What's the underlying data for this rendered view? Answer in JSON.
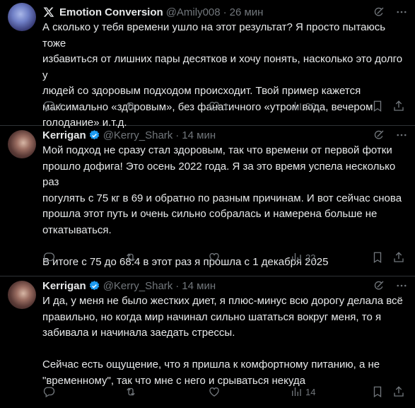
{
  "tweets": [
    {
      "name": "Emotion Conversion",
      "handle": "@Amily008",
      "time": "26 мин",
      "text": "А сколько у тебя времени ушло на этот результат? Я просто пытаюсь тоже\nизбавиться от лишних пары десятков и хочу понять, насколько это долго у\nлюдей со здоровым подходом происходит. Твой пример кажется\nмаксимально «здоровым», без фанатичного «утром вода, вечером\nголодание» и.т.д.",
      "replies": "1",
      "retweets": "",
      "likes": "1",
      "views": "30"
    },
    {
      "name": "Kerrigan",
      "handle": "@Kerry_Shark",
      "time": "14 мин",
      "text": "Мой подход не сразу стал здоровым, так что времени от первой фотки\nпрошло дофига! Это осень 2022 года. Я за это время успела несколько раз\nпогулять с 75 кг в 69 и обратно по разным причинам. И вот сейчас снова\nпрошла этот путь и очень сильно собралась и намерена больше не\nоткатываться.\n\nВ итоге с 75 до 68.4 в этот раз я прошла с 1 декабря 2025",
      "replies": "",
      "retweets": "",
      "likes": "",
      "views": "22"
    },
    {
      "name": "Kerrigan",
      "handle": "@Kerry_Shark",
      "time": "14 мин",
      "text": "И да, у меня не было жестких диет, я плюс-минус всю дорогу делала всё\nправильно, но когда мир начинал сильно шататься вокруг меня, то я\nзабивала и начинала заедать стрессы.\n\nСейчас есть ощущение, что я пришла к комфортному питанию, а не\n\"временному\", так что мне с него и срываться некуда",
      "replies": "",
      "retweets": "",
      "likes": "",
      "views": "14"
    }
  ],
  "separator": "·",
  "colors": {
    "background": "#000000",
    "text": "#e7e9ea",
    "muted": "#71767b",
    "verified": "#1d9bf0",
    "border": "#2f3336"
  },
  "icons": [
    "x-logo-icon",
    "verified-badge-icon",
    "grok-icon",
    "more-icon",
    "reply-icon",
    "retweet-icon",
    "like-icon",
    "views-icon",
    "bookmark-icon",
    "share-icon"
  ]
}
